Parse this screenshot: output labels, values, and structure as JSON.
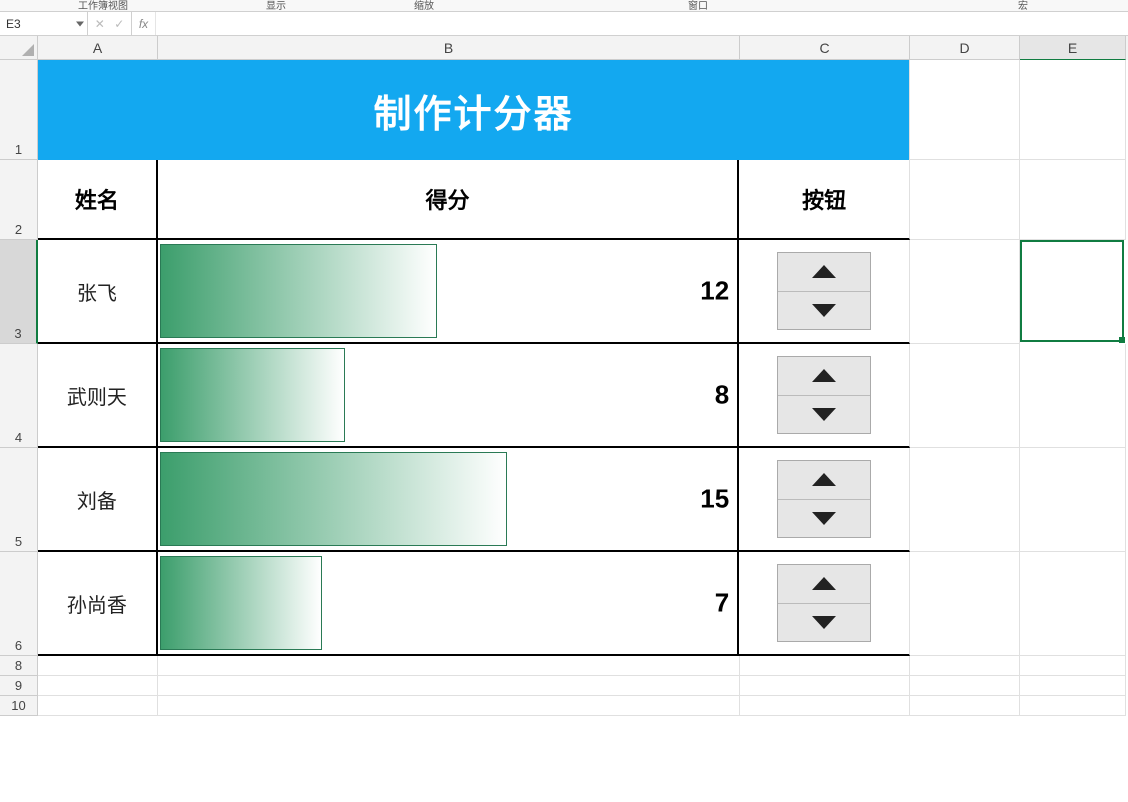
{
  "ribbon": {
    "group1": "工作簿视图",
    "group2": "显示",
    "group3": "缩放",
    "group4": "窗口",
    "group5": "宏"
  },
  "formula_bar": {
    "namebox": "E3",
    "cancel_glyph": "✕",
    "confirm_glyph": "✓",
    "fx_label": "fx",
    "value": ""
  },
  "columns": {
    "A": "A",
    "B": "B",
    "C": "C",
    "D": "D",
    "E": "E"
  },
  "rows": {
    "r1": "1",
    "r2": "2",
    "r3": "3",
    "r4": "4",
    "r5": "5",
    "r6": "6",
    "r8": "8",
    "r9": "9",
    "r10": "10"
  },
  "board": {
    "title": "制作计分器",
    "headers": {
      "name": "姓名",
      "score": "得分",
      "button": "按钮"
    },
    "bar_max": 25,
    "bar_colors": {
      "start": "#3c9e6c",
      "end": "#ffffff"
    },
    "rows": [
      {
        "name": "张飞",
        "score": 12
      },
      {
        "name": "武则天",
        "score": 8
      },
      {
        "name": "刘备",
        "score": 15
      },
      {
        "name": "孙尚香",
        "score": 7
      }
    ]
  },
  "selection": {
    "address": "E3"
  },
  "chart_data": {
    "type": "bar",
    "categories": [
      "张飞",
      "武则天",
      "刘备",
      "孙尚香"
    ],
    "values": [
      12,
      8,
      15,
      7
    ],
    "title": "制作计分器",
    "xlabel": "得分",
    "ylabel": "姓名",
    "ylim": [
      0,
      25
    ]
  }
}
